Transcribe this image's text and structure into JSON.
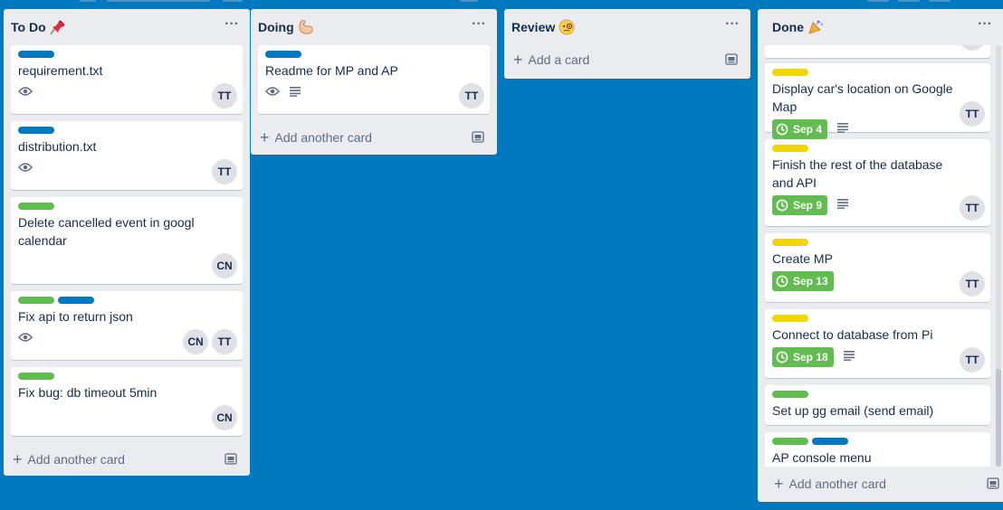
{
  "colors": {
    "board_bg": "#0079bf",
    "list_bg": "#ebecf0",
    "label_blue": "#0079bf",
    "label_green": "#61bd4f",
    "label_yellow": "#f2d600",
    "due_green": "#61bd4f"
  },
  "lists": [
    {
      "title": "To Do",
      "emoji": "pushpin-icon",
      "add_label": "Add another card",
      "cards": [
        {
          "title": "requirement.txt",
          "labels": [
            "blue"
          ],
          "watch": true,
          "members": [
            "TT"
          ]
        },
        {
          "title": "distribution.txt",
          "labels": [
            "blue"
          ],
          "watch": true,
          "members": [
            "TT"
          ]
        },
        {
          "title": "Delete cancelled event in googl calendar",
          "labels": [
            "green"
          ],
          "members": [
            "CN"
          ]
        },
        {
          "title": "Fix api to return json",
          "labels": [
            "green",
            "blue"
          ],
          "watch": true,
          "members": [
            "CN",
            "TT"
          ]
        },
        {
          "title": "Fix bug: db timeout 5min",
          "labels": [
            "green"
          ],
          "members": [
            "CN"
          ]
        }
      ]
    },
    {
      "title": "Doing",
      "emoji": "flexed-biceps-icon",
      "add_label": "Add another card",
      "cards": [
        {
          "title": "Readme for MP and AP",
          "labels": [
            "blue"
          ],
          "watch": true,
          "description": true,
          "members": [
            "TT"
          ]
        }
      ]
    },
    {
      "title": "Review",
      "emoji": "face-with-monocle-icon",
      "add_label": "Add a card",
      "cards": []
    },
    {
      "title": "Done",
      "emoji": "party-popper-icon",
      "add_label": "Add another card",
      "cards": [
        {
          "title": "Display car's location on Google Map",
          "labels": [
            "yellow"
          ],
          "due": "Sep 4",
          "description": true,
          "members": [
            "TT"
          ]
        },
        {
          "title": "Finish the rest of the database and API",
          "labels": [
            "yellow"
          ],
          "due": "Sep 9",
          "description": true,
          "members": [
            "TT"
          ]
        },
        {
          "title": "Create MP",
          "labels": [
            "yellow"
          ],
          "due": "Sep 13",
          "members": [
            "TT"
          ]
        },
        {
          "title": "Connect to database from Pi",
          "labels": [
            "yellow"
          ],
          "due": "Sep 18",
          "description": true,
          "members": [
            "TT"
          ]
        },
        {
          "title": "Set up gg email (send email)",
          "labels": [
            "green"
          ]
        },
        {
          "title": "AP console menu",
          "labels": [
            "green",
            "blue"
          ]
        }
      ]
    }
  ]
}
